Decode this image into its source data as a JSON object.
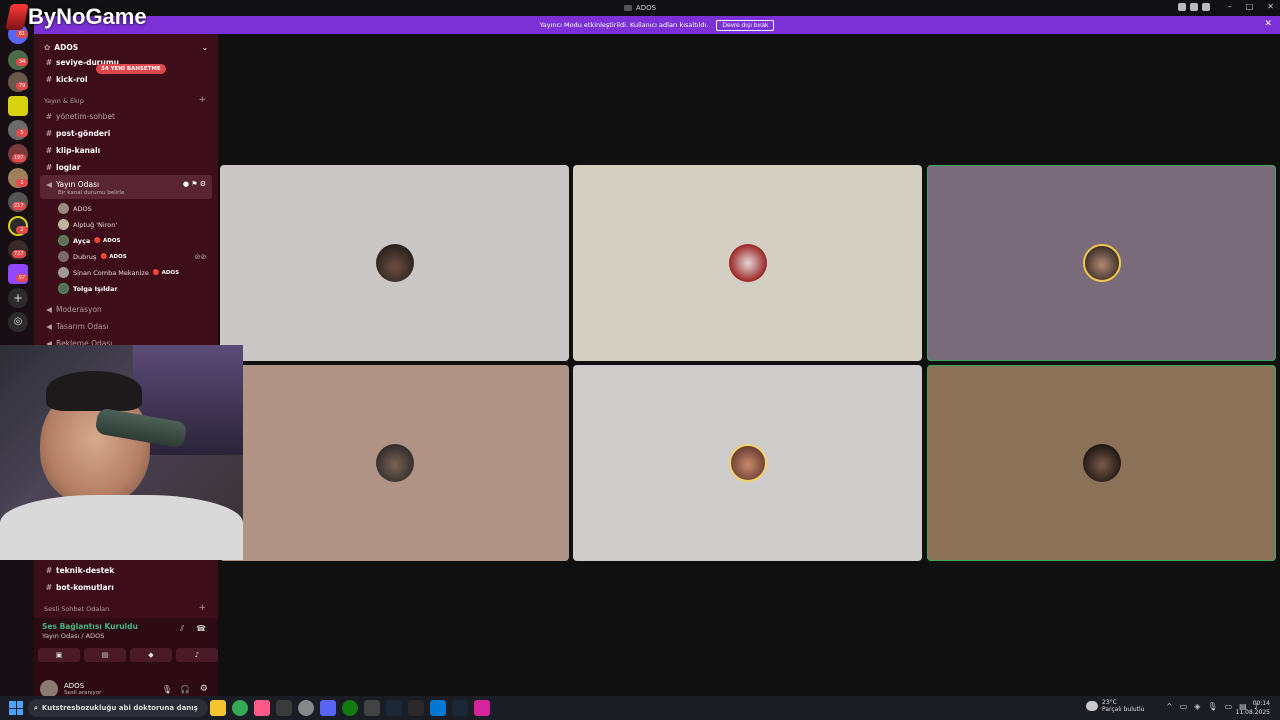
{
  "window": {
    "title": "ADOS"
  },
  "banner": {
    "text": "Yayıncı Modu etkinleştirildi. Kullanıcı adları kısaltıldı.",
    "button": "Devre dışı bırak"
  },
  "logo": {
    "text": "ByNoGame"
  },
  "rail_badges": [
    "81",
    "34",
    "79",
    "5",
    "197",
    "1",
    "217",
    "2",
    "727",
    "97"
  ],
  "sidebar": {
    "server_name": "ADOS",
    "mention_badge": "34 YENİ BAHSETME",
    "top_channels": [
      "seviye-durumu",
      "kick-rol"
    ],
    "category_stream": "Yayın & Ekip",
    "channels": [
      "yönetim-sohbet",
      "post-gönderi",
      "klip-kanalı",
      "loglar"
    ],
    "voice_channel": {
      "name": "Yayın Odası",
      "status": "Bir kanal durumu belirle"
    },
    "voice_users": [
      {
        "name": "ADOS",
        "tag": ""
      },
      {
        "name": "Alptuğ 'Niron'",
        "tag": ""
      },
      {
        "name": "Ayça",
        "tag": "ADOS"
      },
      {
        "name": "Dubruş",
        "tag": "ADOS"
      },
      {
        "name": "Sinan Comba Mekanize",
        "tag": "ADOS"
      },
      {
        "name": "Tolga Işıldar",
        "tag": ""
      }
    ],
    "other_voice": [
      "Moderasyon",
      "Tasarım Odası",
      "Bekleme Odası"
    ],
    "bottom_channels": [
      "teknik-destek",
      "bot-komutları"
    ],
    "category_voice": "Sesli Sohbet Odaları"
  },
  "voice_bar": {
    "status": "Ses Bağlantısı Kuruldu",
    "location": "Yayın Odası / ADOS"
  },
  "user_panel": {
    "name": "ADOS",
    "status": "Sesli aranıyor"
  },
  "tiles": [
    {
      "color": "#cbc7c6",
      "speaking": false
    },
    {
      "color": "#d4cfc3",
      "speaking": false
    },
    {
      "color": "#7a6b7b",
      "speaking": true
    },
    {
      "color": "#b09384",
      "speaking": false
    },
    {
      "color": "#cdcccb",
      "speaking": false
    },
    {
      "color": "#8c7159",
      "speaking": true
    }
  ],
  "taskbar": {
    "search_text": "Kutstresbozukluğu abi doktoruna danış",
    "weather_temp": "23°C",
    "weather_desc": "Parçalı bulutlu",
    "time": "00:14",
    "date": "11.08.2025"
  },
  "colors": {
    "accent": "#7b31d6",
    "sidebar": "#3d0d1a",
    "connected": "#43b581",
    "speaking": "#3ba55c"
  }
}
